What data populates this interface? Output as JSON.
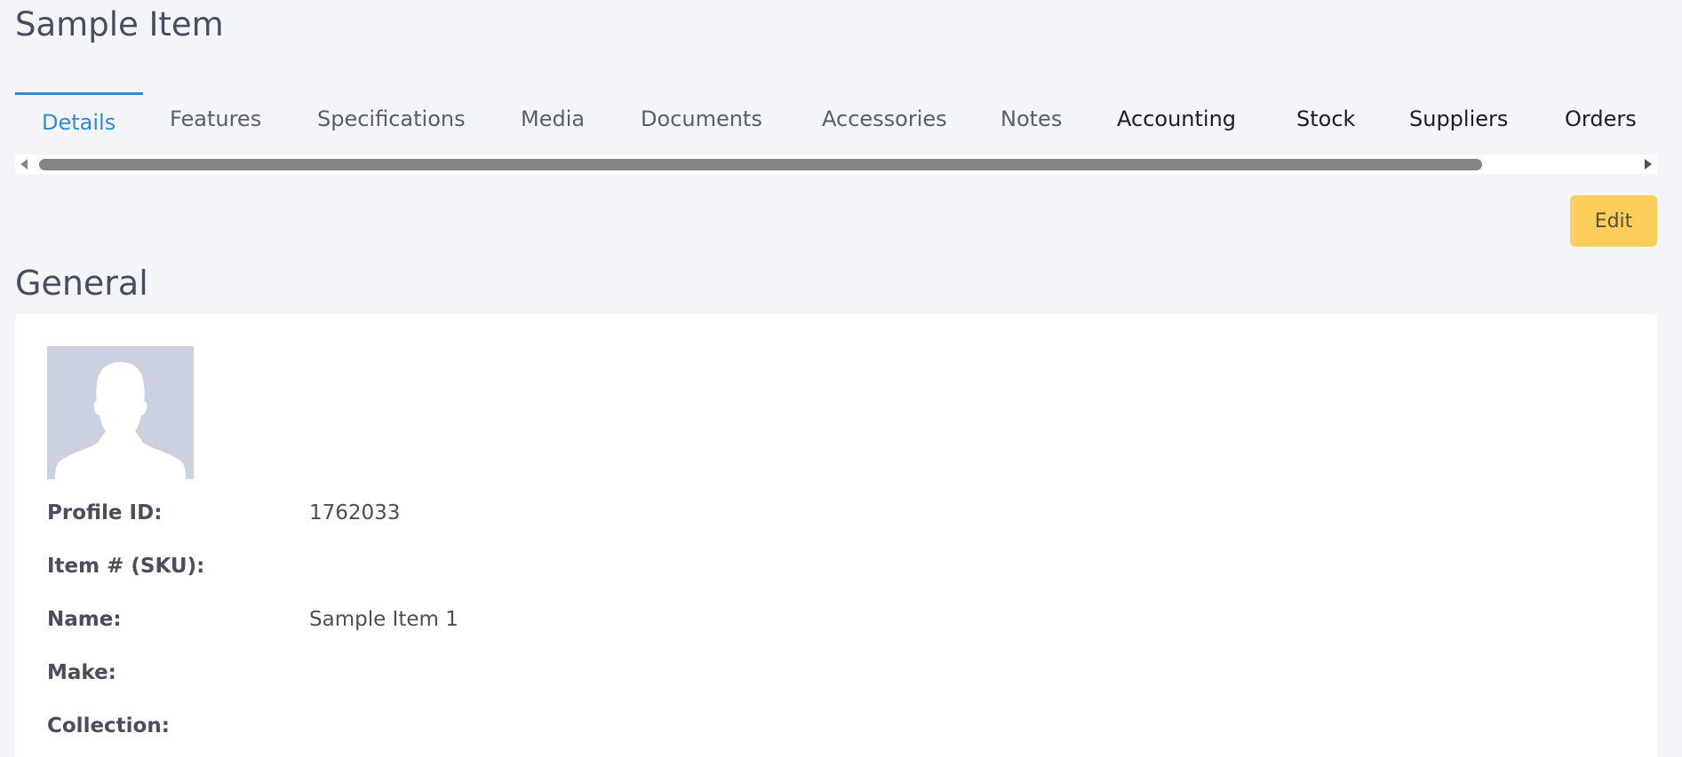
{
  "page": {
    "title": "Sample Item"
  },
  "tabs": [
    {
      "label": "Details",
      "active": true
    },
    {
      "label": "Features"
    },
    {
      "label": "Specifications"
    },
    {
      "label": "Media"
    },
    {
      "label": "Documents"
    },
    {
      "label": "Accessories"
    },
    {
      "label": "Notes"
    },
    {
      "label": "Accounting"
    },
    {
      "label": "Stock"
    },
    {
      "label": "Suppliers"
    },
    {
      "label": "Orders"
    }
  ],
  "actions": {
    "edit_label": "Edit"
  },
  "general": {
    "title": "General",
    "avatar_icon": "user-silhouette-icon",
    "fields": [
      {
        "label": "Profile ID:",
        "value": "1762033"
      },
      {
        "label": "Item # (SKU):",
        "value": ""
      },
      {
        "label": "Name:",
        "value": "Sample Item 1"
      },
      {
        "label": "Make:",
        "value": ""
      },
      {
        "label": "Collection:",
        "value": ""
      }
    ]
  },
  "colors": {
    "accent": "#2d8ad8",
    "edit_button": "#fccf5d",
    "avatar_bg": "#ccd1e2",
    "page_bg": "#f4f5f8"
  }
}
